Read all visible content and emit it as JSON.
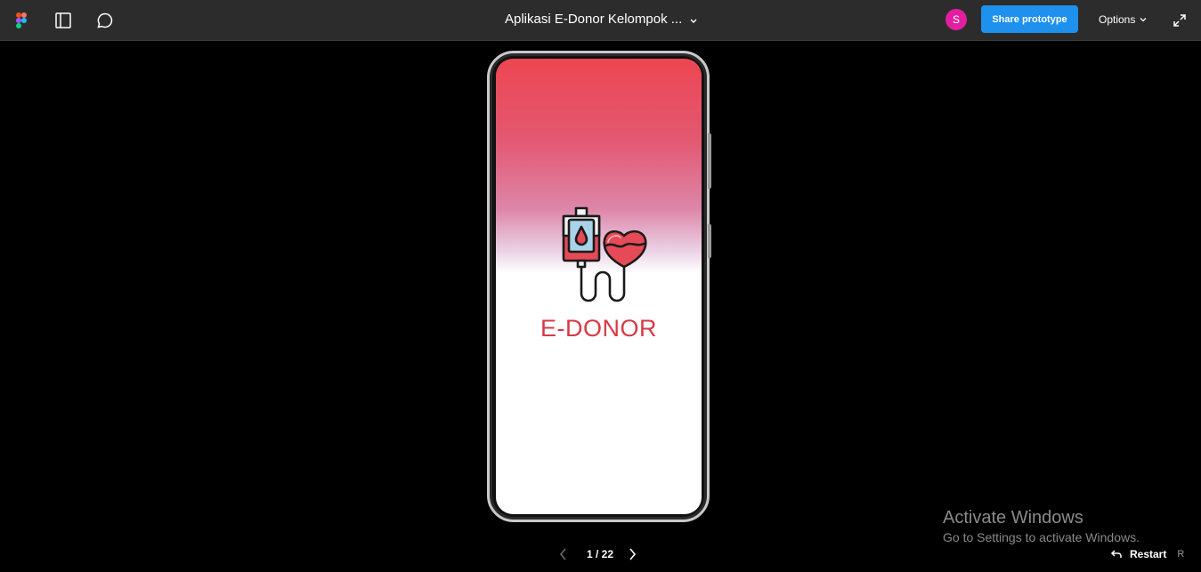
{
  "toolbar": {
    "file_title": "Aplikasi E-Donor Kelompok ...",
    "avatar_initial": "S",
    "share_label": "Share prototype",
    "options_label": "Options",
    "icons": [
      "figma-logo",
      "panel-icon",
      "comment-icon",
      "chevron-down-icon",
      "expand-icon"
    ]
  },
  "prototype": {
    "app_name": "E-DONOR",
    "accent_color": "#d83946",
    "gradient_top": "#ed4651"
  },
  "navigation": {
    "page_counter": "1 / 22",
    "restart_label": "Restart",
    "restart_shortcut": "R"
  },
  "watermark": {
    "title": "Activate Windows",
    "subtitle": "Go to Settings to activate Windows."
  }
}
